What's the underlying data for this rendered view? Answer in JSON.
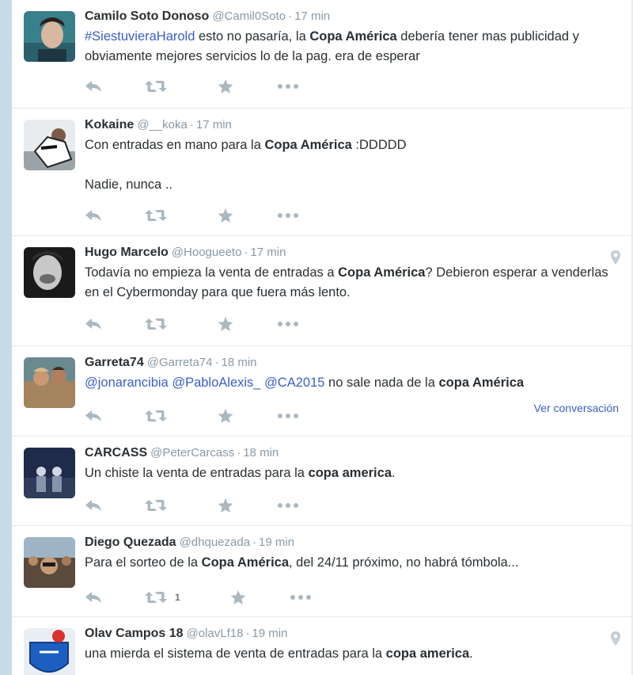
{
  "colors": {
    "link": "#3b5ec9",
    "text": "#292f33",
    "muted": "#8899a6",
    "action_icon": "#aab8c2",
    "rail": "#c5dbe8"
  },
  "icons": {
    "reply": "reply-arrow-icon",
    "retweet": "retweet-icon",
    "favorite": "star-icon",
    "more": "ellipsis-icon",
    "location": "location-pin-icon"
  },
  "tweets": [
    {
      "name": "Camilo Soto Donoso",
      "handle": "@Camil0Soto",
      "sep": "·",
      "time": "17 min",
      "seg": [
        "#SiestuvieraHarold",
        " esto no pasaría, la ",
        "Copa América",
        " debería tener mas publicidad y obviamente mejores servicios lo de la pag. era de esperar"
      ]
    },
    {
      "name": "Kokaine",
      "handle": "@__koka",
      "sep": "·",
      "time": "17 min",
      "seg": [
        "Con entradas en mano para la ",
        "Copa América",
        " :DDDDD\n\nNadie, nunca .."
      ]
    },
    {
      "name": "Hugo Marcelo",
      "handle": "@Hoogueeto",
      "sep": "·",
      "time": "17 min",
      "seg": [
        "Todavía no empieza la venta de entradas a ",
        "Copa América",
        "? Debieron esperar a venderlas en el Cybermonday para que fuera más lento."
      ]
    },
    {
      "name": "Garreta74",
      "handle": "@Garreta74",
      "sep": "·",
      "time": "18 min",
      "seg": [
        "@jonarancibia",
        " ",
        "@PabloAlexis_",
        " ",
        "@CA2015",
        " no sale nada de la ",
        "copa América"
      ],
      "view_conversation": "Ver conversación"
    },
    {
      "name": "CARCASS",
      "handle": "@PeterCarcass",
      "sep": "·",
      "time": "18 min",
      "seg": [
        "Un chiste la venta de entradas para la ",
        "copa america",
        "."
      ]
    },
    {
      "name": "Diego Quezada",
      "handle": "@dhquezada",
      "sep": "·",
      "time": "19 min",
      "seg": [
        "Para el sorteo de la ",
        "Copa América",
        ", del 24/11 próximo, no habrá tómbola..."
      ],
      "retweet_count": "1"
    },
    {
      "name": "Olav Campos 18",
      "handle": "@olavLf18",
      "sep": "·",
      "time": "19 min",
      "seg": [
        "una mierda el sistema de venta de entradas para la ",
        "copa america",
        "."
      ]
    }
  ]
}
